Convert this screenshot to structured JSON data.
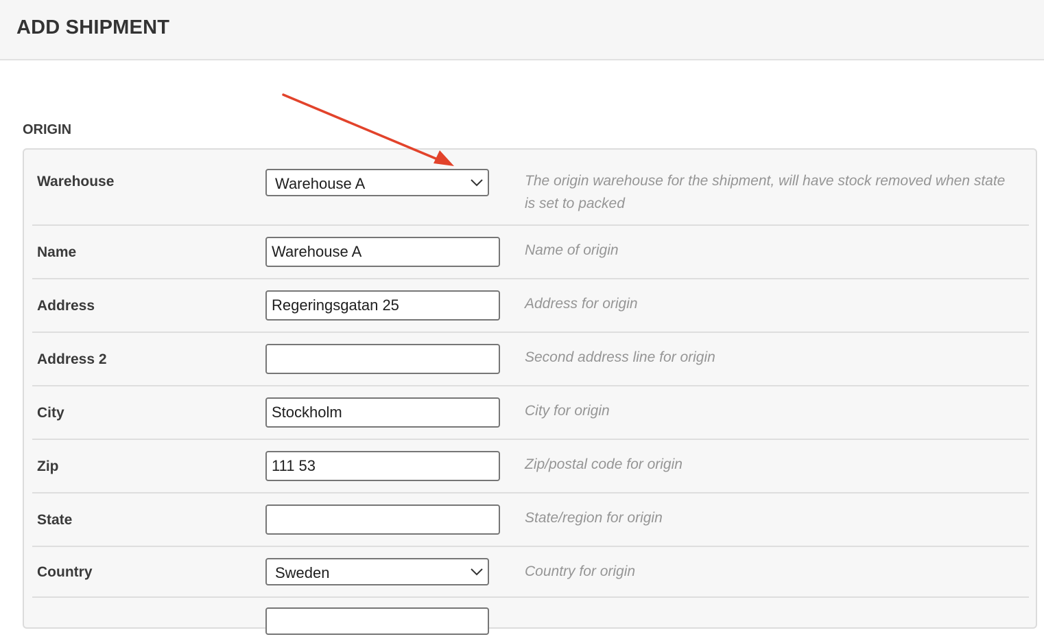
{
  "header": {
    "title": "ADD SHIPMENT"
  },
  "origin": {
    "section_title": "ORIGIN",
    "warehouse": {
      "label": "Warehouse",
      "value": "Warehouse A",
      "help": "The origin warehouse for the shipment, will have stock removed when state is set to packed"
    },
    "name": {
      "label": "Name",
      "value": "Warehouse A",
      "help": "Name of origin"
    },
    "address": {
      "label": "Address",
      "value": "Regeringsgatan 25",
      "help": "Address for origin"
    },
    "address2": {
      "label": "Address 2",
      "value": "",
      "help": "Second address line for origin"
    },
    "city": {
      "label": "City",
      "value": "Stockholm",
      "help": "City for origin"
    },
    "zip": {
      "label": "Zip",
      "value": "111 53",
      "help": "Zip/postal code for origin"
    },
    "state": {
      "label": "State",
      "value": "",
      "help": "State/region for origin"
    },
    "country": {
      "label": "Country",
      "value": "Sweden",
      "help": "Country for origin"
    }
  },
  "annotation": {
    "arrow_color": "#e2432b"
  },
  "icons": {
    "select_chevron": "chevron-down-icon"
  }
}
